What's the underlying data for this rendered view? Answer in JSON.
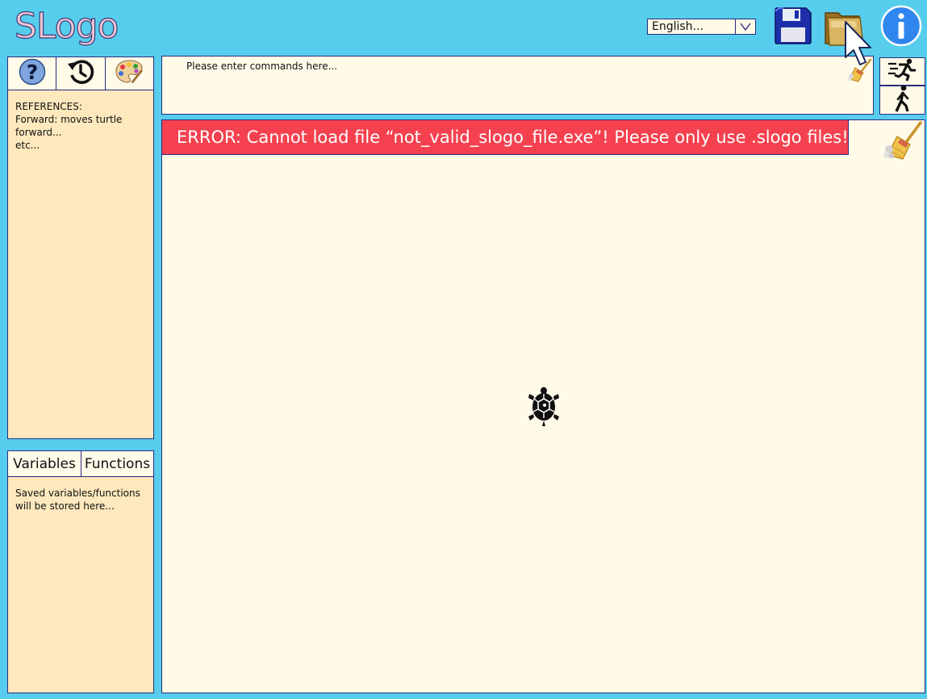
{
  "app": {
    "title": "SLogo"
  },
  "header": {
    "language": "English...",
    "icons": [
      "save-icon",
      "open-folder-icon",
      "info-icon"
    ]
  },
  "left_panel": {
    "tabs": [
      "help-icon",
      "history-icon",
      "palette-icon"
    ],
    "references_text": "REFERENCES:\nForward: moves turtle forward...\netc..."
  },
  "storage_panel": {
    "tabs": [
      "Variables",
      "Functions"
    ],
    "text": "Saved variables/functions will be stored here..."
  },
  "command": {
    "placeholder": "Please enter commands here..."
  },
  "canvas": {
    "error": "ERROR: Cannot load file “not_valid_slogo_file.exe”! Please only use .slogo files!"
  },
  "colors": {
    "background": "#56cdec",
    "panel": "#fee8bd",
    "canvas": "#fffbe8",
    "error": "#f5414f",
    "border": "#2b2b80"
  }
}
